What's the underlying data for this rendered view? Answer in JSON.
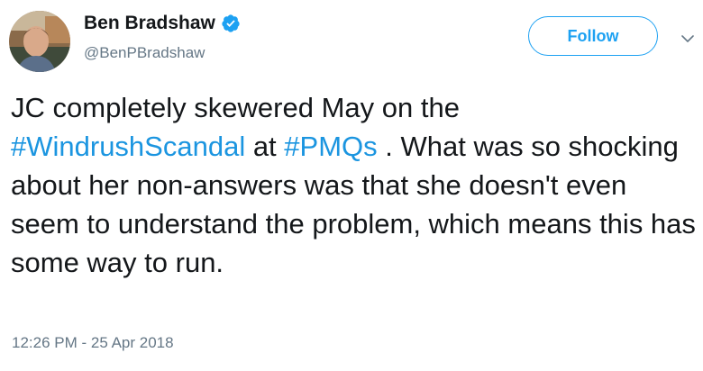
{
  "author": {
    "display_name": "Ben Bradshaw",
    "handle": "@BenPBradshaw",
    "verified": true
  },
  "actions": {
    "follow_label": "Follow",
    "caret_icon": "chevron-down-icon",
    "verified_icon": "verified-badge-icon"
  },
  "tweet": {
    "segments": [
      {
        "text": "JC completely skewered May on the "
      },
      {
        "text": "#WindrushScandal",
        "hashtag": true
      },
      {
        "text": " at "
      },
      {
        "text": "#PMQs",
        "hashtag": true
      },
      {
        "text": " . What was so shocking about her non-answers was that she doesn't even seem to understand the problem, which means this has some way to run."
      }
    ],
    "timestamp": "12:26 PM - 25 Apr 2018"
  },
  "colors": {
    "accent": "#1da1f2",
    "hashtag": "#1b95e0",
    "text": "#14171a",
    "secondary": "#657786"
  }
}
